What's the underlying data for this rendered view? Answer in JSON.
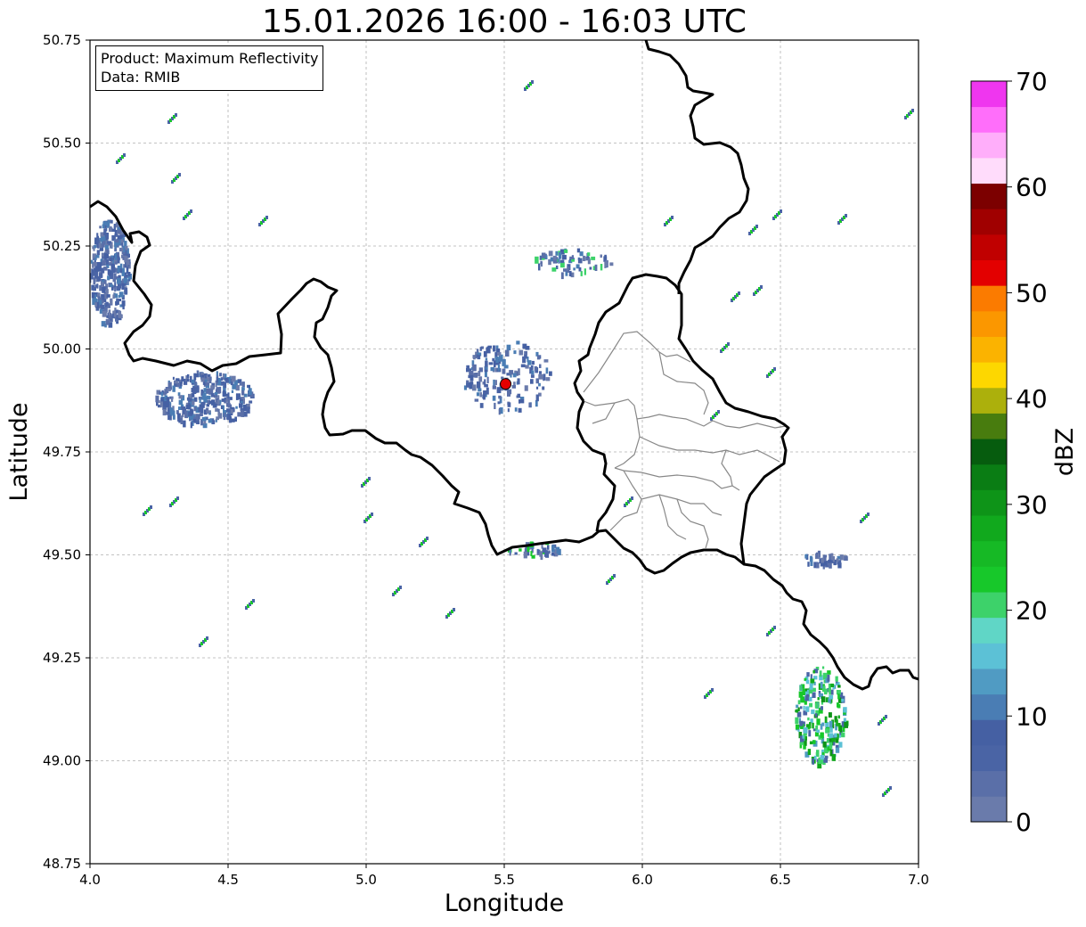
{
  "title": "15.01.2026 16:00 - 16:03 UTC",
  "xlabel": "Longitude",
  "ylabel": "Latitude",
  "info_box": {
    "product": "Product: Maximum Reflectivity",
    "data": "Data: RMIB"
  },
  "colorbar": {
    "label": "dBZ",
    "min": 0,
    "max": 70,
    "ticks": [
      "0",
      "10",
      "20",
      "30",
      "40",
      "50",
      "60",
      "70"
    ],
    "colors": [
      "#6a7bab",
      "#5a6fa8",
      "#4a64a5",
      "#4560a3",
      "#4a7db4",
      "#509bc3",
      "#5cc1d6",
      "#60d6c6",
      "#3dd26a",
      "#17c82a",
      "#16b925",
      "#11a91d",
      "#0e9418",
      "#0a7d14",
      "#065c0e",
      "#487c0e",
      "#acb00c",
      "#fdd700",
      "#fbb300",
      "#fb9700",
      "#fb7b00",
      "#e30000",
      "#c00000",
      "#a00000",
      "#7c0000",
      "#ffdcfb",
      "#ffaefa",
      "#ff6efa",
      "#ef36ef"
    ]
  },
  "map": {
    "x_range": [
      4.0,
      7.0
    ],
    "y_range": [
      48.75,
      50.75
    ],
    "x_ticks": [
      "4.0",
      "4.5",
      "5.0",
      "5.5",
      "6.0",
      "6.5",
      "7.0"
    ],
    "y_ticks": [
      "48.75",
      "49.00",
      "49.25",
      "49.50",
      "49.75",
      "50.00",
      "50.25",
      "50.50",
      "50.75"
    ],
    "grid": true,
    "radar_site": {
      "lon": 5.505,
      "lat": 49.915,
      "color": "#e50000"
    },
    "border_color": "#000000",
    "district_color": "#888888"
  }
}
